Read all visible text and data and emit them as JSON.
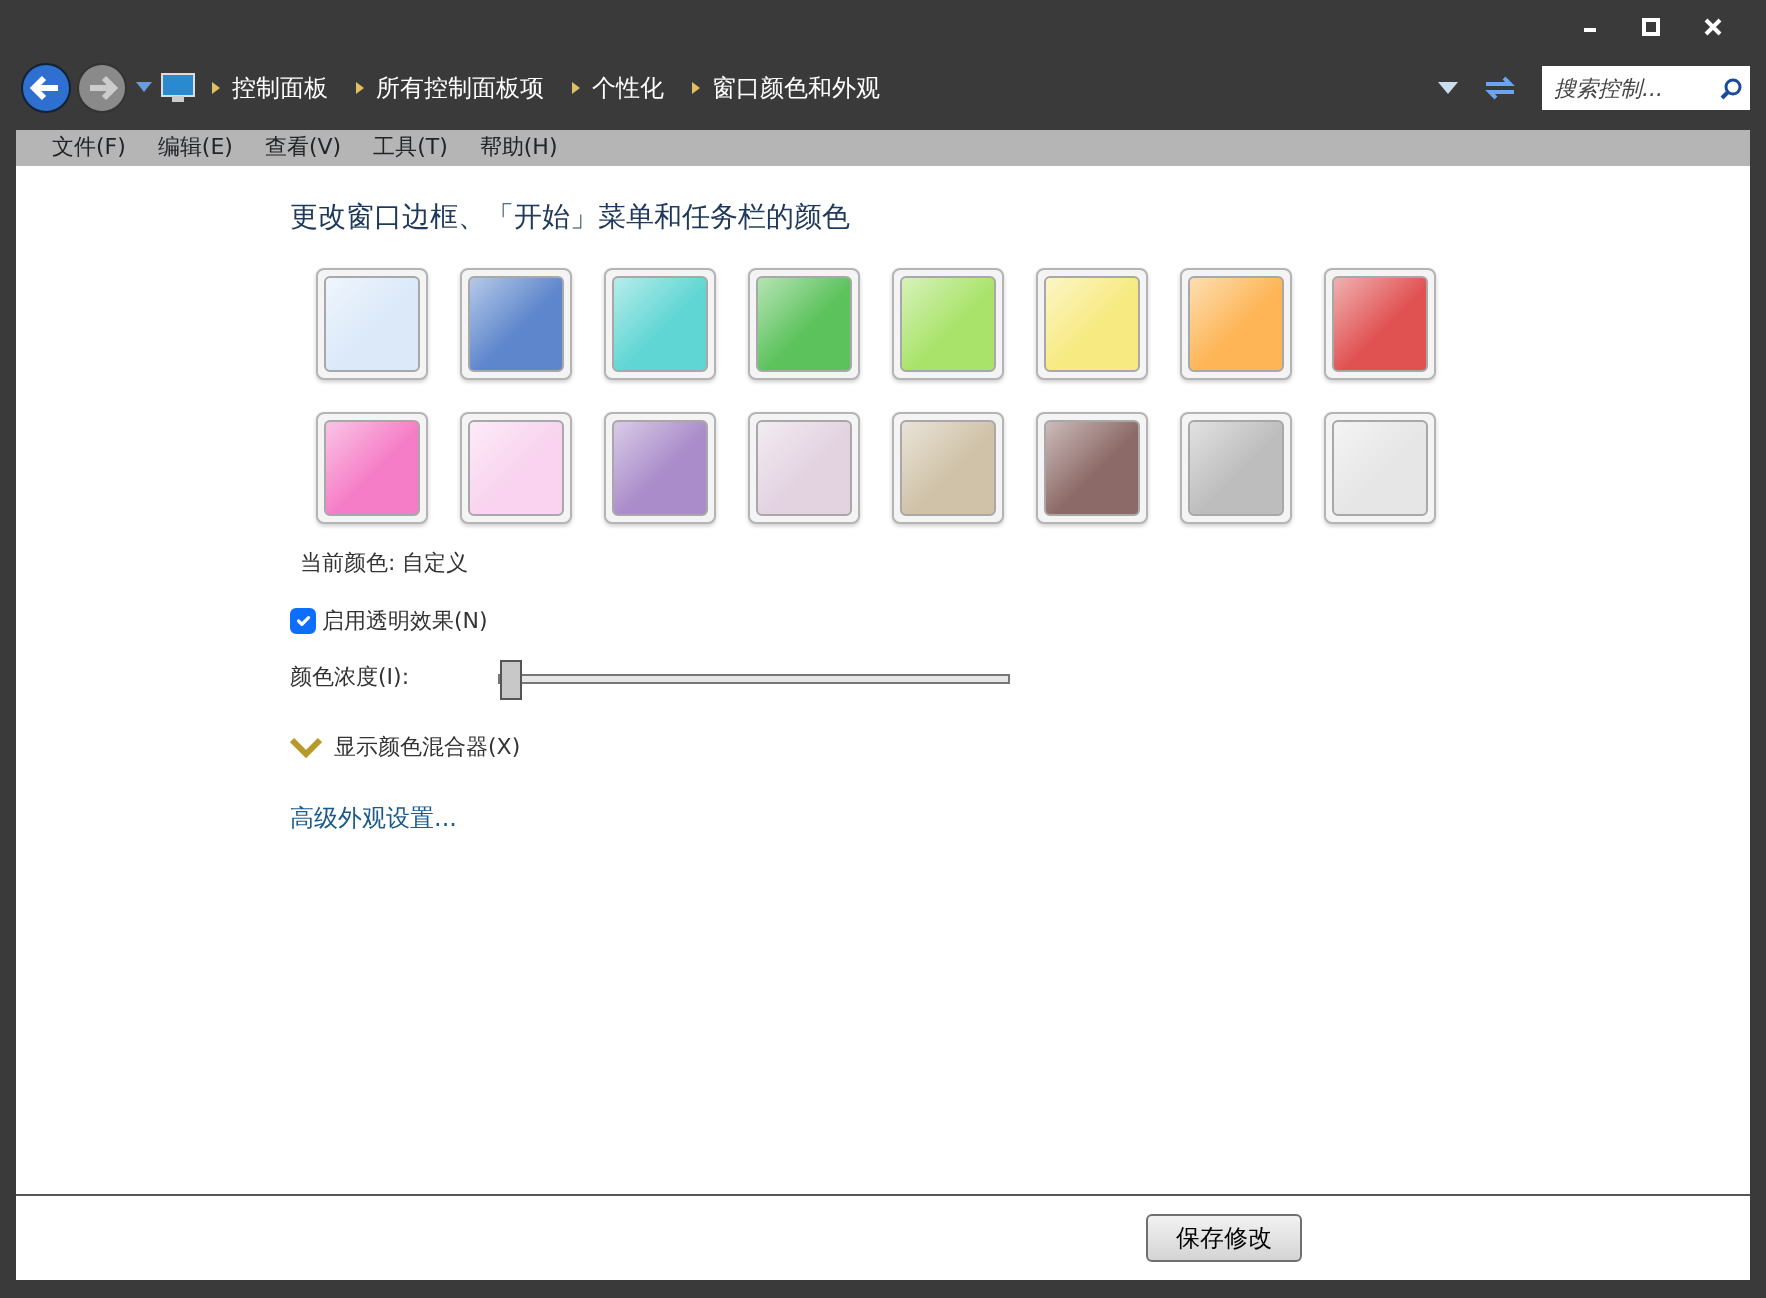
{
  "breadcrumb": [
    "控制面板",
    "所有控制面板项",
    "个性化",
    "窗口颜色和外观"
  ],
  "search": {
    "placeholder": "搜索控制..."
  },
  "menu": [
    "文件(F)",
    "编辑(E)",
    "查看(V)",
    "工具(T)",
    "帮助(H)"
  ],
  "heading": "更改窗口边框、「开始」菜单和任务栏的颜色",
  "swatches": [
    {
      "color": "#dbe9f9"
    },
    {
      "color": "#5d86cc"
    },
    {
      "color": "#5fd6d3"
    },
    {
      "color": "#5cc25c"
    },
    {
      "color": "#a9e36a"
    },
    {
      "color": "#f7ea80"
    },
    {
      "color": "#fdb555"
    },
    {
      "color": "#e05252"
    },
    {
      "color": "#f57cc6"
    },
    {
      "color": "#f9d3ef"
    },
    {
      "color": "#a98cc9"
    },
    {
      "color": "#e3d3e1"
    },
    {
      "color": "#cfc2a8"
    },
    {
      "color": "#8c6a67"
    },
    {
      "color": "#bdbdbd"
    },
    {
      "color": "#e6e6e6"
    }
  ],
  "current_color": "当前颜色: 自定义",
  "transparency": {
    "label": "启用透明效果(N)",
    "checked": true
  },
  "intensity": {
    "label": "颜色浓度(I):",
    "level": 0.0
  },
  "mixer": {
    "label": "显示颜色混合器(X)",
    "expanded": false
  },
  "advanced_link": "高级外观设置...",
  "save_button": "保存修改"
}
